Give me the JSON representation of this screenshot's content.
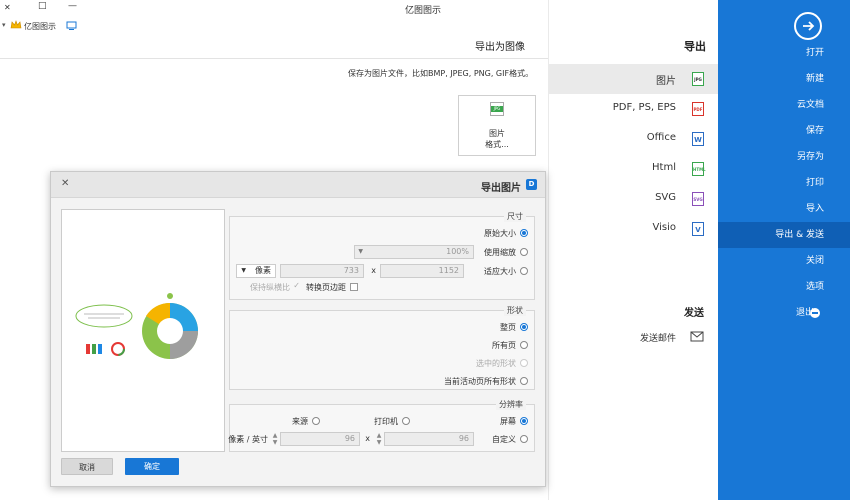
{
  "window": {
    "title": "亿图图示",
    "app_name": "亿图图示",
    "minimize": "—",
    "restore": "□",
    "close": "✕"
  },
  "sidebar": {
    "items": [
      {
        "label": "打开"
      },
      {
        "label": "新建"
      },
      {
        "label": "云文档"
      },
      {
        "label": "保存"
      },
      {
        "label": "另存为"
      },
      {
        "label": "打印"
      },
      {
        "label": "导入"
      },
      {
        "label": "导出 & 发送"
      },
      {
        "label": "关闭"
      },
      {
        "label": "选项"
      },
      {
        "label": "退出"
      }
    ],
    "active_index": 7
  },
  "export_panel": {
    "heading": "导出",
    "items": [
      {
        "label": "图片",
        "icon": "JPG"
      },
      {
        "label": "PDF, PS, EPS",
        "icon": "PDF"
      },
      {
        "label": "Office",
        "icon": "W"
      },
      {
        "label": "Html",
        "icon": "HTML"
      },
      {
        "label": "SVG",
        "icon": "SVG"
      },
      {
        "label": "Visio",
        "icon": "V"
      }
    ],
    "send_heading": "发送",
    "send_item": "发送邮件"
  },
  "right_panel": {
    "heading": "导出为图像",
    "description": "保存为图片文件，比如BMP, JPEG, PNG, GIF格式。",
    "card_icon": "JPG",
    "card_label_line1": "图片",
    "card_label_line2": "格式..."
  },
  "dialog": {
    "title": "导出图片",
    "close": "✕",
    "size_group": {
      "title": "尺寸",
      "opt_original": "原始大小",
      "opt_zoom": "使用缩放",
      "zoom_value": "100%",
      "opt_fit": "适应大小",
      "width": "1152",
      "x": "x",
      "height": "733",
      "unit": "像素",
      "keep_margin": "转换页边距",
      "keep_ratio": "保持纵横比"
    },
    "shape_group": {
      "title": "形状",
      "opt_all": "整页",
      "opt_all_pages": "所有页",
      "opt_selected": "选中的形状",
      "opt_current_all": "当前活动页所有形状"
    },
    "resolution_group": {
      "title": "分辨率",
      "opt_screen": "屏幕",
      "opt_printer": "打印机",
      "opt_source": "来源",
      "opt_custom": "自定义",
      "dpi_x": "96",
      "x": "x",
      "dpi_y": "96",
      "unit": "像素 / 英寸"
    },
    "ok": "确定",
    "cancel": "取消"
  },
  "colors": {
    "sidebar": "#1877d6",
    "sidebar_active": "#0f5fb5",
    "ok_button": "#1877d6"
  }
}
